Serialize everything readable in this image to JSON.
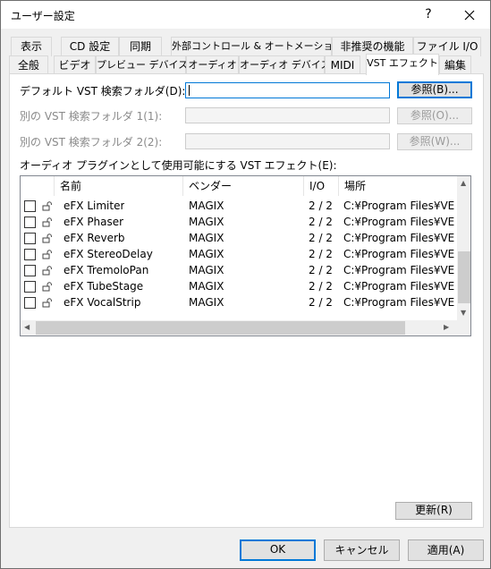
{
  "window": {
    "title": "ユーザー設定",
    "help_label": "?",
    "close_label": "✕"
  },
  "tabs": {
    "row1": [
      "表示",
      "CD 設定",
      "同期",
      "外部コントロール & オートメーション",
      "非推奨の機能",
      "ファイル I/O"
    ],
    "row2": [
      "全般",
      "ビデオ",
      "プレビュー デバイス",
      "オーディオ",
      "オーディオ デバイス",
      "MIDI",
      "VST エフェクト",
      "編集"
    ],
    "active": "VST エフェクト"
  },
  "vst": {
    "default_folder_label": "デフォルト VST 検索フォルダ(D):",
    "default_folder_value": "",
    "alt_folder1_label": "別の VST 検索フォルダ 1(1):",
    "alt_folder2_label": "別の VST 検索フォルダ 2(2):",
    "browse_b": "参照(B)...",
    "browse_o": "参照(O)...",
    "browse_w": "参照(W)...",
    "list_label": "オーディオ プラグインとして使用可能にする VST エフェクト(E):",
    "columns": [
      "名前",
      "ベンダー",
      "I/O",
      "場所"
    ],
    "rows": [
      {
        "name": "eFX Limiter",
        "vendor": "MAGIX",
        "io": "2 / 2",
        "location": "C:¥Program Files¥VEGA"
      },
      {
        "name": "eFX Phaser",
        "vendor": "MAGIX",
        "io": "2 / 2",
        "location": "C:¥Program Files¥VEGA"
      },
      {
        "name": "eFX Reverb",
        "vendor": "MAGIX",
        "io": "2 / 2",
        "location": "C:¥Program Files¥VEGA"
      },
      {
        "name": "eFX StereoDelay",
        "vendor": "MAGIX",
        "io": "2 / 2",
        "location": "C:¥Program Files¥VEGA"
      },
      {
        "name": "eFX TremoloPan",
        "vendor": "MAGIX",
        "io": "2 / 2",
        "location": "C:¥Program Files¥VEGA"
      },
      {
        "name": "eFX TubeStage",
        "vendor": "MAGIX",
        "io": "2 / 2",
        "location": "C:¥Program Files¥VEGA"
      },
      {
        "name": "eFX VocalStrip",
        "vendor": "MAGIX",
        "io": "2 / 2",
        "location": "C:¥Program Files¥VEGA"
      }
    ],
    "refresh_label": "更新(R)"
  },
  "footer": {
    "ok_label": "OK",
    "cancel_label": "キャンセル",
    "apply_label": "適用(A)"
  },
  "colors": {
    "accent": "#0078d7",
    "window_bg": "#f0f0f0"
  }
}
